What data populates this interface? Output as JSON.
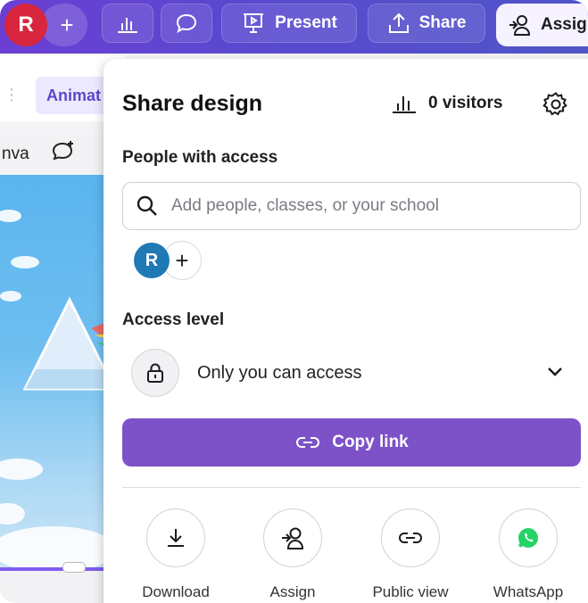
{
  "toolbar": {
    "avatar_initial": "R",
    "add_label": "+",
    "present_label": "Present",
    "share_label": "Share",
    "assign_label": "Assig"
  },
  "editor": {
    "animate_label": "Animat",
    "canva_label": "nva"
  },
  "share_panel": {
    "title": "Share design",
    "visitors": "0 visitors",
    "people_heading": "People with access",
    "search_placeholder": "Add people, classes, or your school",
    "people": [
      {
        "initial": "R",
        "color": "#1f79b5"
      }
    ],
    "add_person_label": "+",
    "access_heading": "Access level",
    "access_value": "Only you can access",
    "copy_link_label": "Copy link",
    "options": [
      {
        "label": "Download",
        "icon": "download-icon"
      },
      {
        "label": "Assign",
        "icon": "assign-icon"
      },
      {
        "label": "Public view",
        "icon": "link-icon"
      },
      {
        "label": "WhatsApp",
        "icon": "whatsapp-icon"
      }
    ]
  },
  "colors": {
    "toolbar": "#5a48cf",
    "avatar": "#d7263d",
    "accent": "#7d52c8",
    "person_avatar": "#1f79b5",
    "whatsapp": "#25d366"
  }
}
